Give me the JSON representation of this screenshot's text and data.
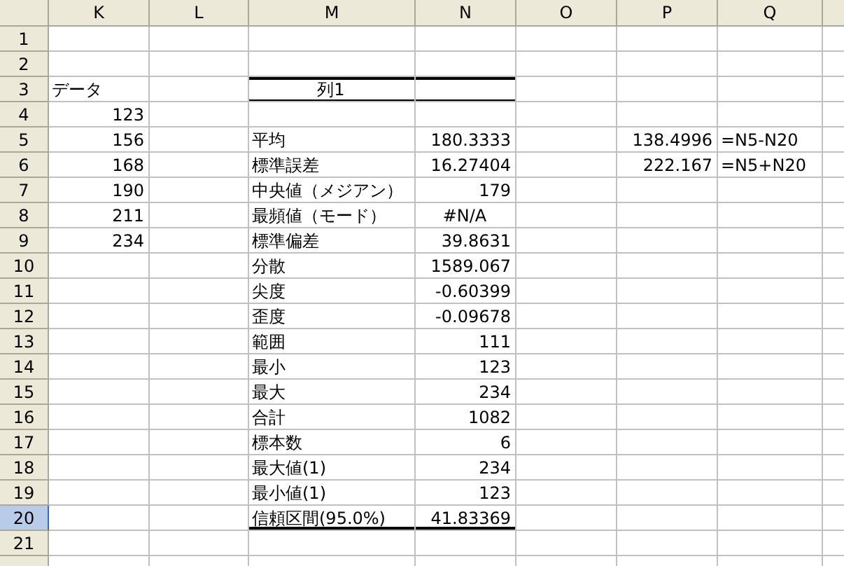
{
  "columns": [
    "K",
    "L",
    "M",
    "N",
    "O",
    "P",
    "Q"
  ],
  "rows": [
    {
      "label": "1",
      "selected": false,
      "cells": {}
    },
    {
      "label": "2",
      "selected": false,
      "cells": {}
    },
    {
      "label": "3",
      "selected": false,
      "cells": {
        "K": {
          "text": "データ",
          "kind": "text"
        },
        "M": {
          "text": "列1",
          "kind": "heading",
          "thick_top": true,
          "thin_bottom": true
        },
        "N": {
          "kind": "heading",
          "thick_top": true,
          "thin_bottom": true
        }
      }
    },
    {
      "label": "4",
      "selected": false,
      "cells": {
        "K": {
          "text": "123",
          "kind": "number"
        }
      }
    },
    {
      "label": "5",
      "selected": false,
      "cells": {
        "K": {
          "text": "156",
          "kind": "number"
        },
        "M": {
          "text": "平均",
          "kind": "text"
        },
        "N": {
          "text": "180.3333",
          "kind": "number"
        },
        "P": {
          "text": "138.4996",
          "kind": "number"
        },
        "Q": {
          "text": "=N5-N20",
          "kind": "text"
        }
      }
    },
    {
      "label": "6",
      "selected": false,
      "cells": {
        "K": {
          "text": "168",
          "kind": "number"
        },
        "M": {
          "text": "標準誤差",
          "kind": "text"
        },
        "N": {
          "text": "16.27404",
          "kind": "number"
        },
        "P": {
          "text": "222.167",
          "kind": "number"
        },
        "Q": {
          "text": "=N5+N20",
          "kind": "text"
        }
      }
    },
    {
      "label": "7",
      "selected": false,
      "cells": {
        "K": {
          "text": "190",
          "kind": "number"
        },
        "M": {
          "text": "中央値（メジアン）",
          "kind": "text"
        },
        "N": {
          "text": "179",
          "kind": "number"
        }
      }
    },
    {
      "label": "8",
      "selected": false,
      "cells": {
        "K": {
          "text": "211",
          "kind": "number"
        },
        "M": {
          "text": "最頻値（モード）",
          "kind": "text"
        },
        "N": {
          "text": "#N/A",
          "kind": "error"
        }
      }
    },
    {
      "label": "9",
      "selected": false,
      "cells": {
        "K": {
          "text": "234",
          "kind": "number"
        },
        "M": {
          "text": "標準偏差",
          "kind": "text"
        },
        "N": {
          "text": "39.8631",
          "kind": "number"
        }
      }
    },
    {
      "label": "10",
      "selected": false,
      "cells": {
        "M": {
          "text": "分散",
          "kind": "text"
        },
        "N": {
          "text": "1589.067",
          "kind": "number"
        }
      }
    },
    {
      "label": "11",
      "selected": false,
      "cells": {
        "M": {
          "text": "尖度",
          "kind": "text"
        },
        "N": {
          "text": "-0.60399",
          "kind": "number"
        }
      }
    },
    {
      "label": "12",
      "selected": false,
      "cells": {
        "M": {
          "text": "歪度",
          "kind": "text"
        },
        "N": {
          "text": "-0.09678",
          "kind": "number"
        }
      }
    },
    {
      "label": "13",
      "selected": false,
      "cells": {
        "M": {
          "text": "範囲",
          "kind": "text"
        },
        "N": {
          "text": "111",
          "kind": "number"
        }
      }
    },
    {
      "label": "14",
      "selected": false,
      "cells": {
        "M": {
          "text": "最小",
          "kind": "text"
        },
        "N": {
          "text": "123",
          "kind": "number"
        }
      }
    },
    {
      "label": "15",
      "selected": false,
      "cells": {
        "M": {
          "text": "最大",
          "kind": "text"
        },
        "N": {
          "text": "234",
          "kind": "number"
        }
      }
    },
    {
      "label": "16",
      "selected": false,
      "cells": {
        "M": {
          "text": "合計",
          "kind": "text"
        },
        "N": {
          "text": "1082",
          "kind": "number"
        }
      }
    },
    {
      "label": "17",
      "selected": false,
      "cells": {
        "M": {
          "text": "標本数",
          "kind": "text"
        },
        "N": {
          "text": "6",
          "kind": "number"
        }
      }
    },
    {
      "label": "18",
      "selected": false,
      "cells": {
        "M": {
          "text": "最大値(1)",
          "kind": "text"
        },
        "N": {
          "text": "234",
          "kind": "number"
        }
      }
    },
    {
      "label": "19",
      "selected": false,
      "cells": {
        "M": {
          "text": "最小値(1)",
          "kind": "text"
        },
        "N": {
          "text": "123",
          "kind": "number"
        }
      }
    },
    {
      "label": "20",
      "selected": true,
      "cells": {
        "M": {
          "text": "信頼区間(95.0%)",
          "kind": "text",
          "thick_bottom": true
        },
        "N": {
          "text": "41.83369",
          "kind": "number",
          "thick_bottom": true
        }
      }
    },
    {
      "label": "21",
      "selected": false,
      "cells": {}
    }
  ]
}
